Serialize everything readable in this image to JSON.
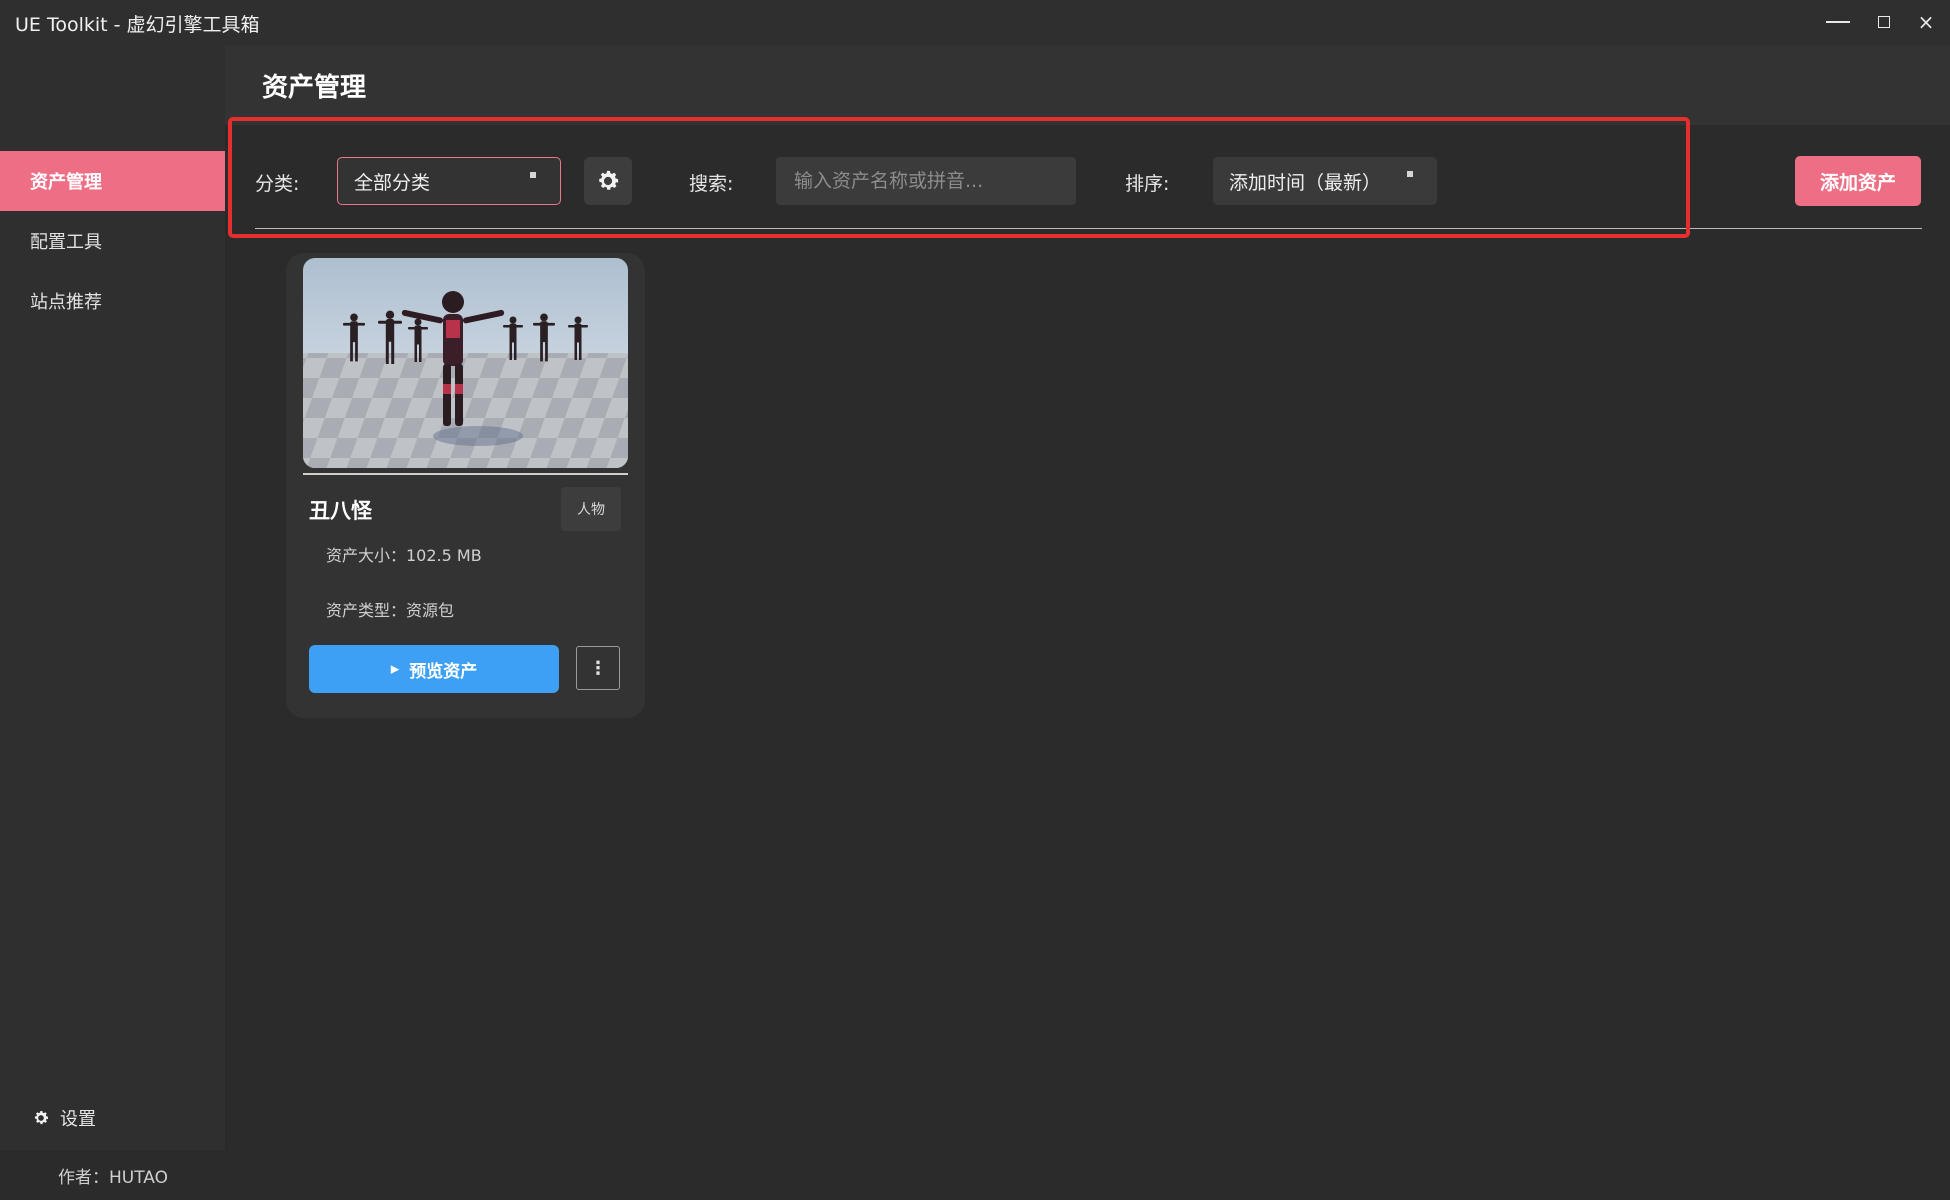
{
  "window": {
    "title": "UE Toolkit - 虚幻引擎工具箱",
    "controls": [
      "minimize-icon",
      "maximize-icon",
      "close-icon"
    ],
    "close_glyph": "×"
  },
  "sidebar": {
    "items": [
      {
        "label": "资产管理",
        "active": true
      },
      {
        "label": "配置工具",
        "active": false
      },
      {
        "label": "站点推荐",
        "active": false
      }
    ],
    "settings_label": "设置",
    "accent": "#ee6f85"
  },
  "footer": {
    "author": "作者：HUTAO"
  },
  "header": {
    "title": "资产管理"
  },
  "toolbar": {
    "category_label": "分类:",
    "category_value": "全部分类",
    "search_label": "搜索:",
    "search_placeholder": "输入资产名称或拼音...",
    "sort_label": "排序:",
    "sort_value": "添加时间（最新）",
    "add_button": "添加资产",
    "highlight_color": "#e52e2e"
  },
  "assets": [
    {
      "name": "丑八怪",
      "tag": "人物",
      "size": "资产大小：102.5 MB",
      "type": "资产类型：资源包",
      "preview_button": "预览资产",
      "more_glyph": "⋮",
      "play_glyph": "▸"
    }
  ]
}
